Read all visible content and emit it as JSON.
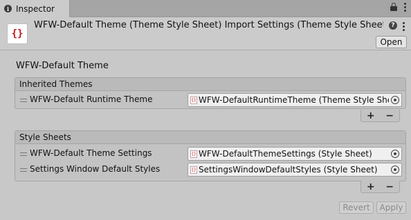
{
  "tab": {
    "label": "Inspector"
  },
  "header": {
    "title": "WFW-Default Theme (Theme Style Sheet) Import Settings (Theme Style Sheet Imp",
    "asset_icon": "{}",
    "open_label": "Open"
  },
  "main": {
    "section_title": "WFW-Default Theme",
    "inherited_themes": {
      "header": "Inherited Themes",
      "items": [
        {
          "label": "WFW-Default Runtime Theme",
          "value": "WFW-DefaultRuntimeTheme (Theme Style Sheet"
        }
      ]
    },
    "style_sheets": {
      "header": "Style Sheets",
      "items": [
        {
          "label": "WFW-Default Theme Settings",
          "value": "WFW-DefaultThemeSettings (Style Sheet)"
        },
        {
          "label": "Settings Window Default Styles",
          "value": "SettingsWindowDefaultStyles (Style Sheet)"
        }
      ]
    },
    "plus": "+",
    "minus": "−"
  },
  "footer": {
    "revert_label": "Revert",
    "apply_label": "Apply"
  },
  "colors": {
    "asset_icon_red": "#c01818",
    "panel_bg": "#c3c3c3"
  }
}
